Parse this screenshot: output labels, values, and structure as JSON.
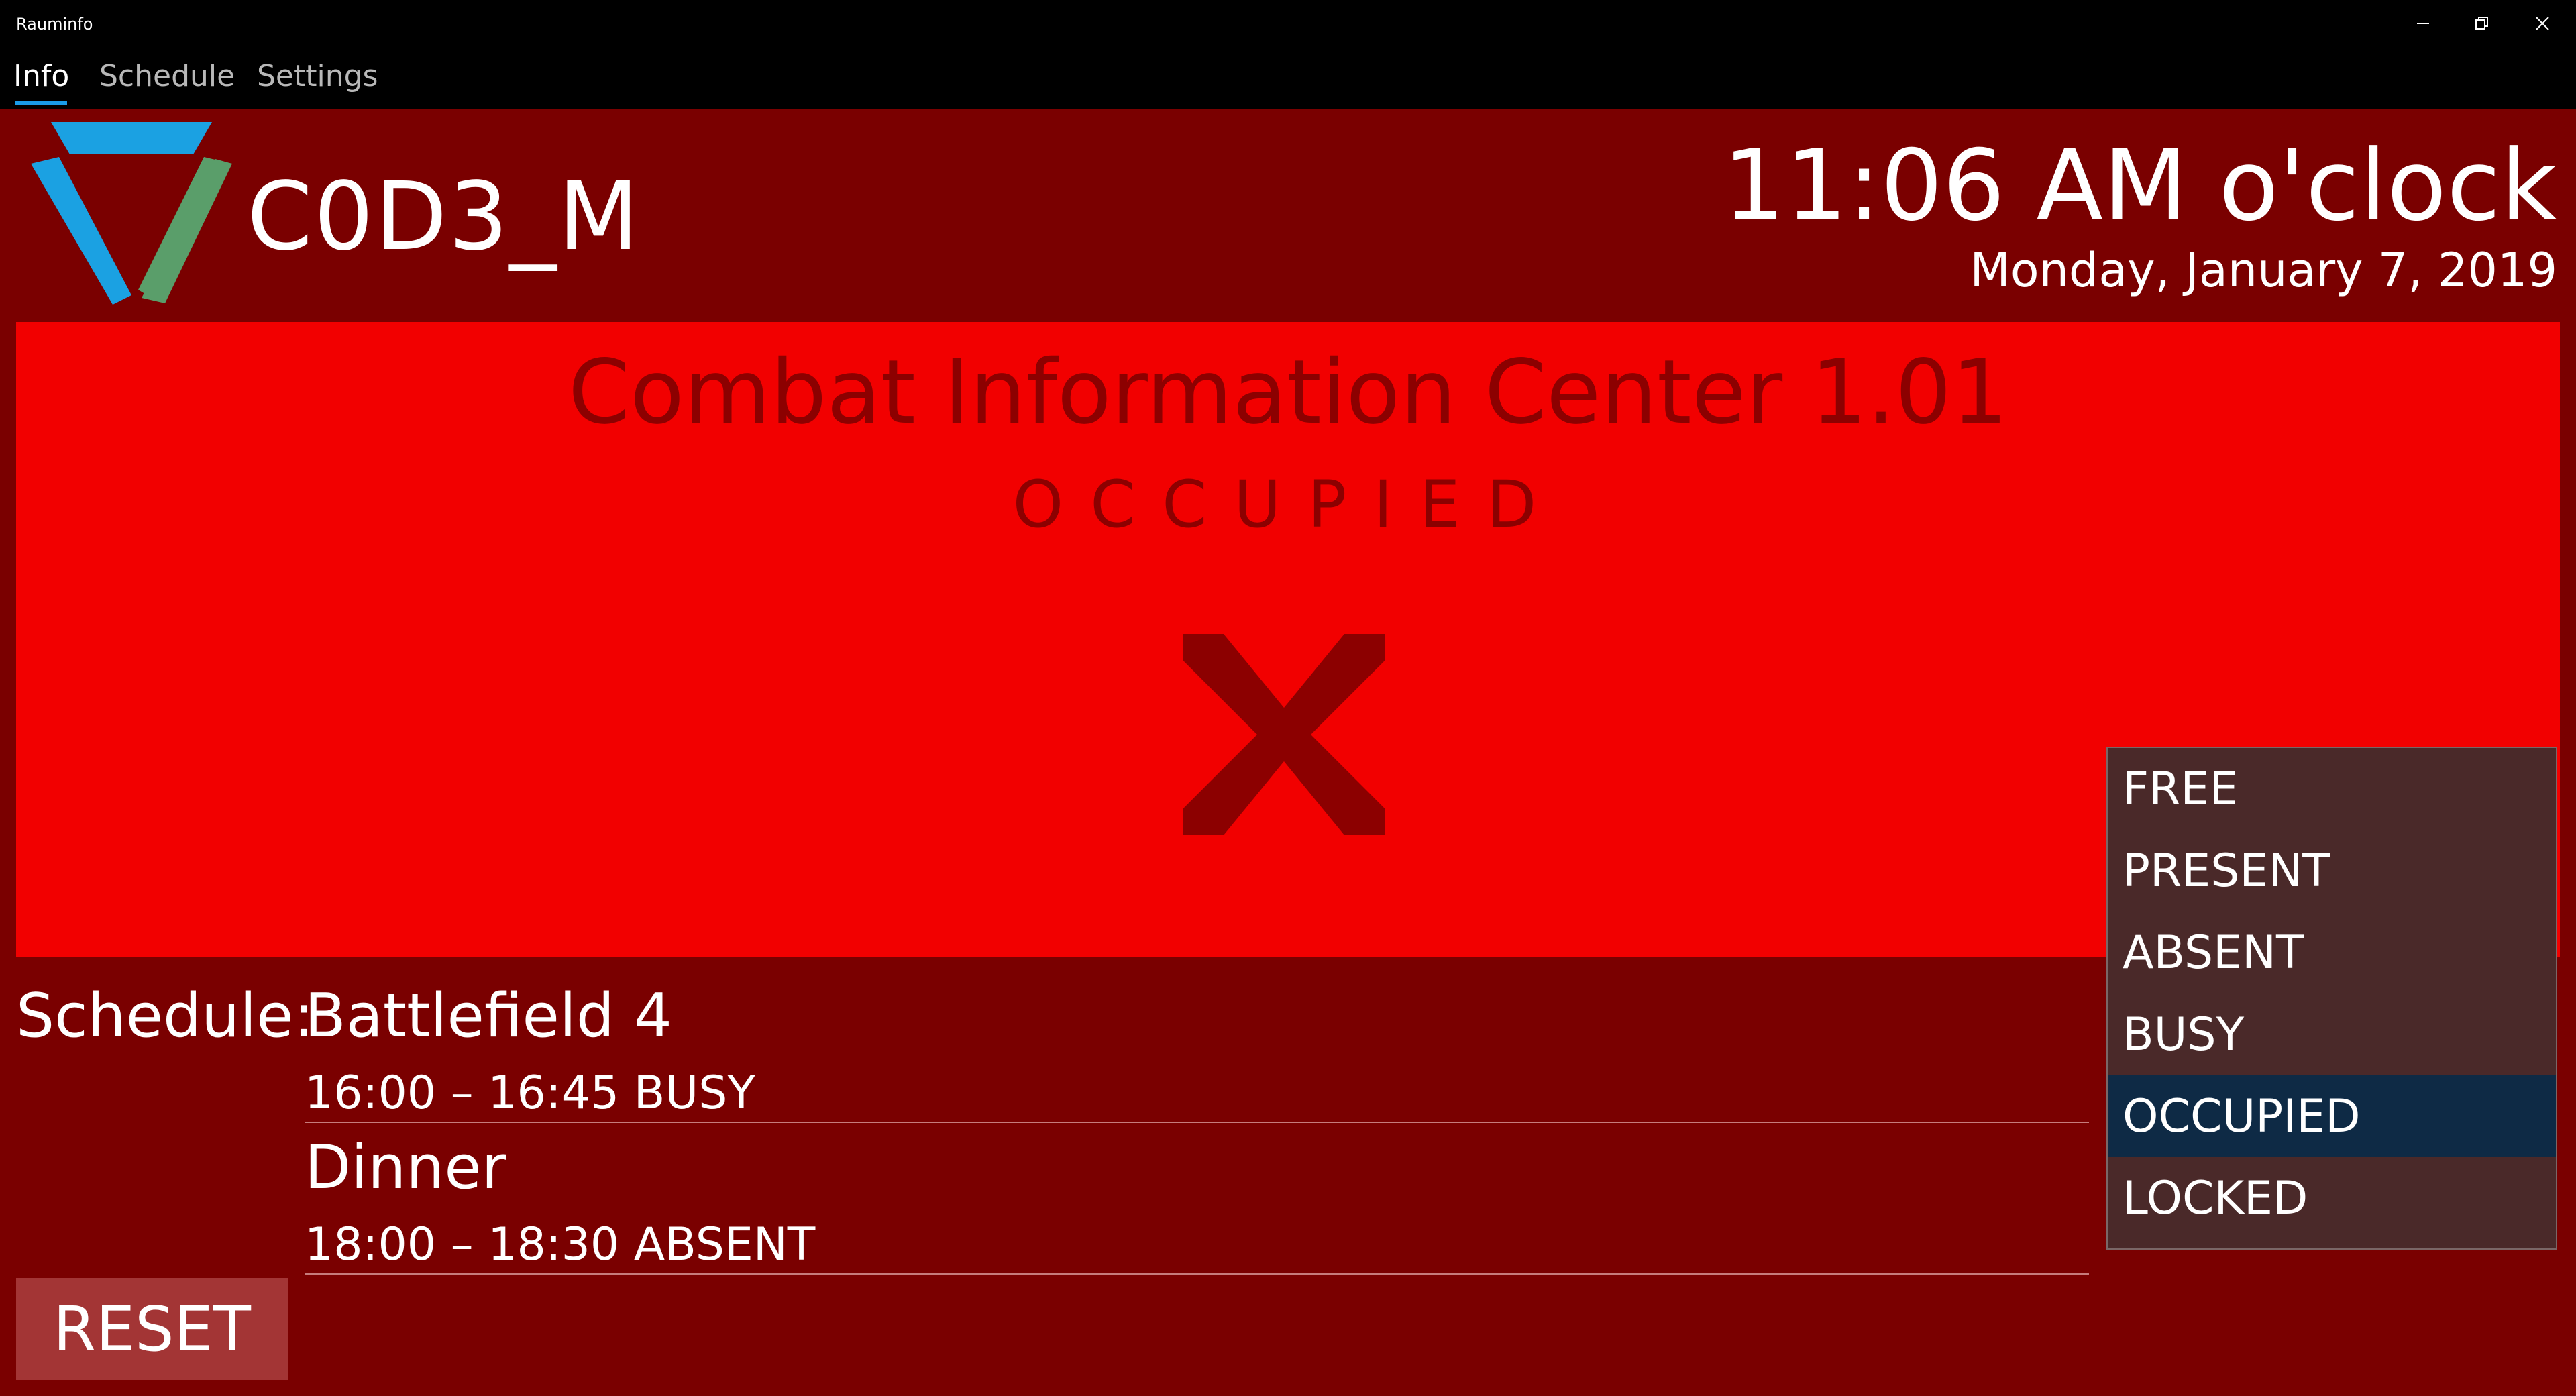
{
  "window": {
    "title": "Rauminfo"
  },
  "nav": {
    "tabs": [
      {
        "label": "Info",
        "active": true
      },
      {
        "label": "Schedule",
        "active": false
      },
      {
        "label": "Settings",
        "active": false
      }
    ]
  },
  "header": {
    "room_code": "C0D3_M",
    "time": "11:06 AM o'clock",
    "date": "Monday, January 7, 2019"
  },
  "status": {
    "room_name": "Combat Information Center  1.01",
    "state": "OCCUPIED",
    "icon": "x-icon",
    "panel_color": "#f20000",
    "text_color": "#8c0000"
  },
  "schedule": {
    "label": "Schedule:",
    "entries": [
      {
        "title": "Battlefield 4",
        "time": "16:00 – 16:45  BUSY"
      },
      {
        "title": "Dinner",
        "time": "18:00 – 18:30  ABSENT"
      }
    ]
  },
  "reset": {
    "label": "RESET"
  },
  "status_menu": {
    "options": [
      "FREE",
      "PRESENT",
      "ABSENT",
      "BUSY",
      "OCCUPIED",
      "LOCKED"
    ],
    "selected": "OCCUPIED"
  },
  "colors": {
    "background": "#7a0000",
    "accent": "#1a9be8",
    "logo_blue": "#1ba1e2",
    "logo_green": "#5a9e6a"
  }
}
